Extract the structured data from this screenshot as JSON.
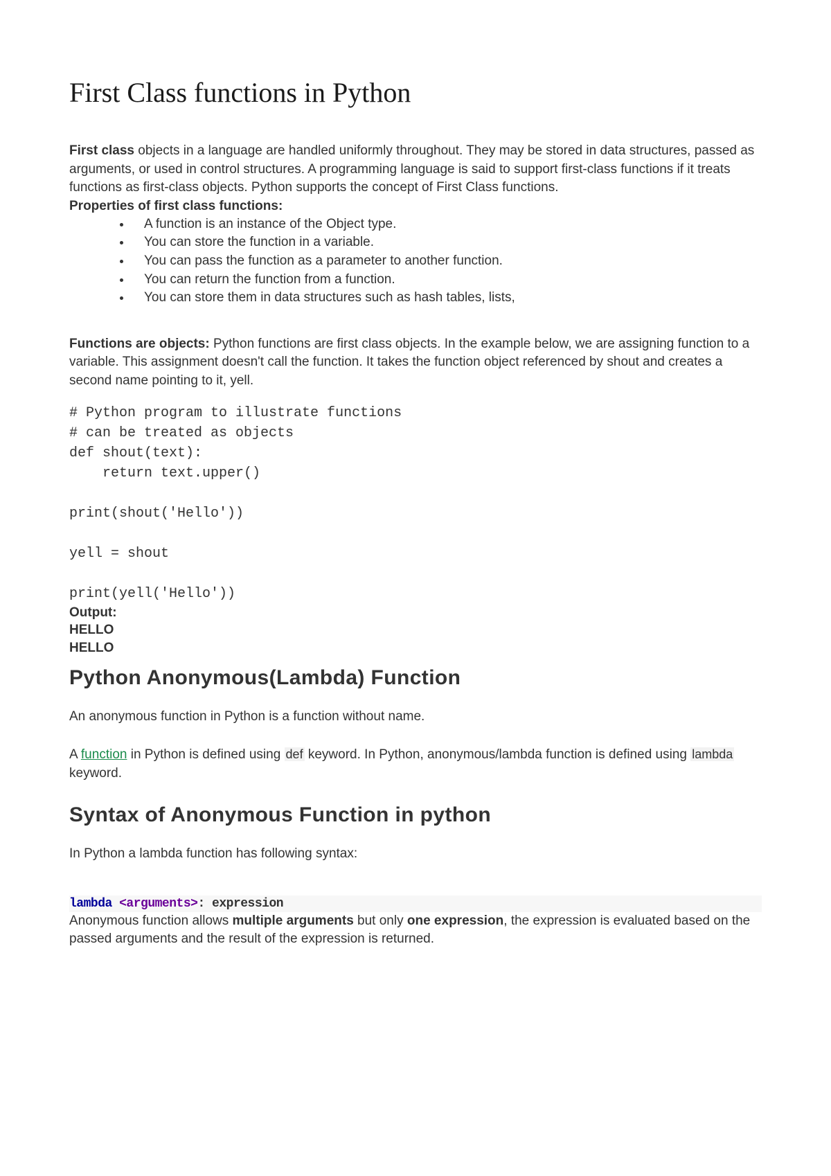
{
  "title": "First Class functions in Python",
  "intro": {
    "bold_lead": "First class",
    "text": " objects in a language are handled uniformly throughout. They may be stored in data structures, passed as arguments, or used in control structures. A programming language is said to support first-class functions if it treats functions as first-class objects. Python supports the concept of First Class functions."
  },
  "properties_label": "Properties of first class functions:",
  "properties": [
    "A function is an instance of the Object type.",
    "You can store the function in a variable.",
    "You can pass the function as a parameter to another function.",
    "You can return the function from a function.",
    "You can store them in data structures such as hash tables, lists,"
  ],
  "functions_objects": {
    "bold_lead": " Functions are objects:",
    "text": " Python functions are first class objects. In the example below, we are assigning function to a variable. This assignment doesn't call the function. It takes the function object referenced by shout and creates a second name pointing to it, yell."
  },
  "code1": "# Python program to illustrate functions\n# can be treated as objects\ndef shout(text):\n    return text.upper()\n\nprint(shout('Hello'))\n\nyell = shout\n\nprint(yell('Hello'))",
  "output_label": "Output:",
  "output_lines": [
    "HELLO",
    "HELLO"
  ],
  "heading_lambda": "Python Anonymous(Lambda) Function",
  "para_anonymous": "An anonymous function in Python is a function without name.",
  "para_def": {
    "pre": "A ",
    "link_text": "function",
    "mid": " in Python is defined using ",
    "code1": "def",
    "post1": " keyword. In Python, anonymous/lambda function is defined using ",
    "code2": "lambda",
    "post2": " keyword."
  },
  "heading_syntax": "Syntax of Anonymous Function in python",
  "para_syntax_intro": "In Python a lambda function has following syntax:",
  "syntax": {
    "kw": "lambda",
    "args": " <arguments>",
    "rest": ": expression"
  },
  "para_final": {
    "pre": "Anonymous function allows ",
    "b1": "multiple arguments",
    "mid": " but only ",
    "b2": "one expression",
    "post": ", the expression is evaluated based on the passed arguments and the result of the expression is returned."
  }
}
